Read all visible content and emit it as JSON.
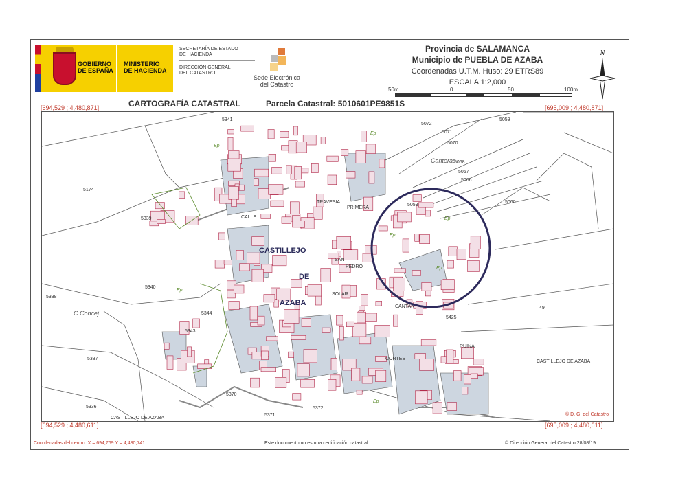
{
  "header": {
    "gov_line1": "GOBIERNO",
    "gov_line2": "DE ESPAÑA",
    "min_line1": "MINISTERIO",
    "min_line2": "DE HACIENDA",
    "sec_estado_1": "SECRETARÍA DE ESTADO",
    "sec_estado_2": "DE HACIENDA",
    "dir_general_1": "DIRECCIÓN GENERAL",
    "dir_general_2": "DEL CATASTRO",
    "sede_1": "Sede Electrónica",
    "sede_2": "del Catastro",
    "provincia": "Provincia de SALAMANCA",
    "municipio": "Municipio de PUEBLA DE AZABA",
    "coordenadas": "Coordenadas U.T.M. Huso: 29 ETRS89",
    "escala": "ESCALA 1:2,000",
    "scale_labels": [
      "50m",
      "0",
      "50",
      "100m"
    ],
    "north": "N",
    "cartografia": "CARTOGRAFÍA CATASTRAL",
    "parcela": "Parcela Catastral: 5010601PE9851S"
  },
  "corners": {
    "top_left": "[694,529 ; 4,480,871]",
    "top_right": "[695,009 ; 4,480,871]",
    "bottom_left": "[694,529 ; 4,480,611]",
    "bottom_right": "[695,009 ; 4,480,611]"
  },
  "map": {
    "town_1": "CASTILLEJO",
    "town_2": "DE",
    "town_3": "AZABA",
    "parcels": [
      "5341",
      "5174",
      "5339",
      "5340",
      "5338",
      "5337",
      "5336",
      "5344",
      "5343",
      "5370",
      "5371",
      "5372",
      "5058",
      "5060",
      "5072",
      "5071",
      "5070",
      "5068",
      "5067",
      "5066",
      "5059",
      "5425",
      "49"
    ],
    "place_canteras": "Canteras",
    "place_concej": "C Concej",
    "castillejo_label": "CASTILLEJO DE AZABA",
    "castillejo_bottom": "CASTILLEJO DE AZABA",
    "streets": [
      "CALLE",
      "TRAVESIA",
      "PRIMERA",
      "SOLAR",
      "SAN",
      "PEDRO",
      "CORTES",
      "RUINA",
      "CANTAN"
    ],
    "ep": "Ep",
    "dg": "© D. G. del Catastro"
  },
  "footer": {
    "centro": "Coordenadas del centro: X = 694,769 Y = 4,480,741",
    "nota": "Este documento no es una certificación catastral",
    "copyright": "© Dirección General del Catastro 28/08/19"
  },
  "colors": {
    "built": "#f3dfe6",
    "courtyard": "#cdd6e0",
    "outline": "#b22a4a",
    "circle": "#2d2a5c"
  }
}
